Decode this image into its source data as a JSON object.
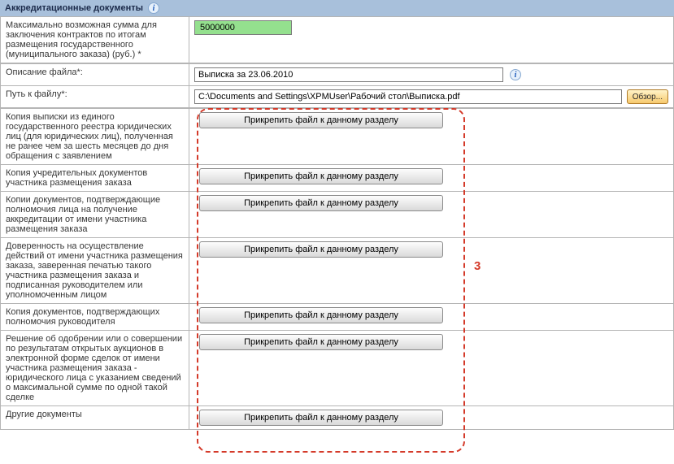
{
  "section": {
    "title": "Аккредитационные документы"
  },
  "maxSum": {
    "label": "Максимально возможная сумма для заключения контрактов по итогам размещения государственного (муниципального заказа) (руб.) *",
    "value": "5000000"
  },
  "fileDesc": {
    "label": "Описание файла*:",
    "value": "Выписка за 23.06.2010"
  },
  "filePath": {
    "label": "Путь к файлу*:",
    "value": "C:\\Documents and Settings\\XPMUser\\Рабочий стол\\Выписка.pdf",
    "browse": "Обзор..."
  },
  "attach": {
    "button": "Прикрепить файл к данному разделу",
    "rows": [
      "Копия выписки из единого государственного реестра юридических лиц (для юридических лиц), полученная не ранее чем за шесть месяцев до дня обращения с заявлением",
      "Копия учредительных документов участника размещения заказа",
      "Копии документов, подтверждающие полномочия лица на получение аккредитации от имени участника размещения заказа",
      "Доверенность на осуществление действий от имени участника размещения заказа, заверенная печатью такого участника размещения заказа и подписанная руководителем или уполномоченным лицом",
      "Копия документов, подтверждающих полномочия руководителя",
      "Решение об одобрении или о совершении по результатам открытых аукционов в электронной форме сделок от имени участника размещения заказа - юридического лица с указанием сведений о максимальной сумме по одной такой сделке",
      "Другие документы"
    ]
  },
  "annotation": "3"
}
